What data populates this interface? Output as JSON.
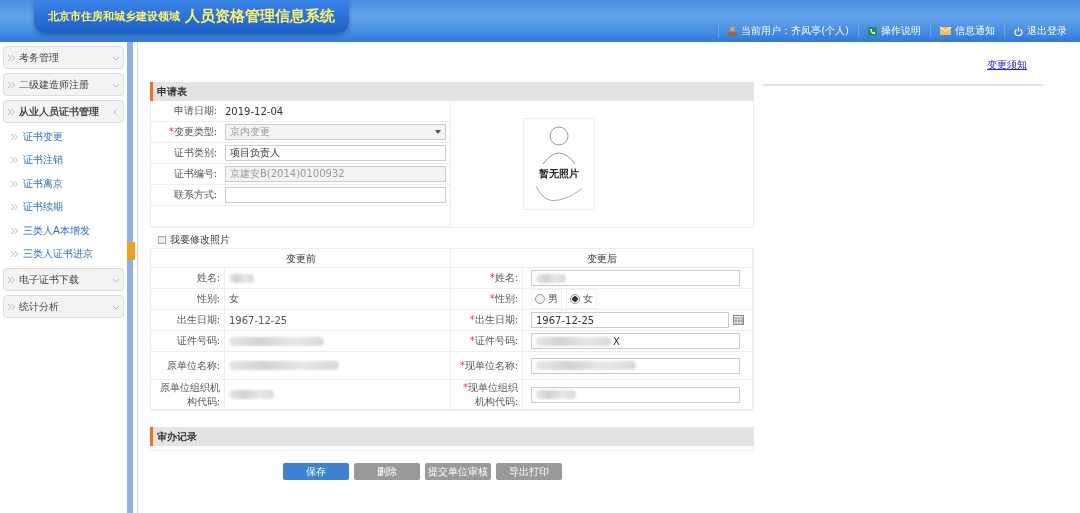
{
  "header": {
    "title_small": "北京市住房和城乡建设领域",
    "title_large": "人员资格管理信息系统",
    "links": [
      {
        "kind": "user",
        "label": "当前用户：齐凤亭(个人)"
      },
      {
        "kind": "help",
        "label": "操作说明"
      },
      {
        "kind": "mail",
        "label": "信息通知"
      },
      {
        "kind": "logout",
        "label": "退出登录"
      }
    ]
  },
  "sidebar": {
    "groups": [
      {
        "label": "考务管理",
        "expanded": false
      },
      {
        "label": "二级建造师注册",
        "expanded": false
      },
      {
        "label": "从业人员证书管理",
        "expanded": true,
        "children": [
          {
            "label": "证书变更"
          },
          {
            "label": "证书注销"
          },
          {
            "label": "证书离京"
          },
          {
            "label": "证书续期"
          },
          {
            "label": "三类人A本增发"
          },
          {
            "label": "三类人证书进京"
          }
        ]
      },
      {
        "label": "电子证书下载",
        "expanded": false
      },
      {
        "label": "统计分析",
        "expanded": false
      }
    ]
  },
  "notice_link": "变更须知",
  "form": {
    "title": "申请表",
    "fields": [
      {
        "kind": "text",
        "label": "申请日期:",
        "value": "2019-12-04"
      },
      {
        "kind": "select",
        "label": "变更类型:",
        "value": "京内变更",
        "required_mark": "*",
        "disabled": true
      },
      {
        "kind": "input",
        "label": "证书类别:",
        "value": "项目负责人"
      },
      {
        "kind": "input",
        "label": "证书编号:",
        "value": "京建安B(2014)0100932",
        "disabled": true
      },
      {
        "kind": "input",
        "label": "联系方式:"
      }
    ],
    "photo": {
      "text": "暂无照片"
    },
    "change_photo": {
      "label": "我要修改照片",
      "checked": false
    },
    "compare": {
      "before_title": "变更前",
      "after_title": "变更后",
      "rows": [
        {
          "before_label": "姓名:",
          "before": {
            "blurred": true
          },
          "after_mark": "*",
          "after_label": "姓名:",
          "after": {
            "kind": "input",
            "blurred": true
          }
        },
        {
          "before_label": "性别:",
          "before": {
            "value": "女",
            "blurred": false
          },
          "after_mark": "*",
          "after_label": "性别:",
          "after": {
            "kind": "radio",
            "options": [
              {
                "label": "男",
                "selected": false
              },
              {
                "label": "女",
                "selected": true
              }
            ]
          }
        },
        {
          "before_label": "出生日期:",
          "before": {
            "value": "1967-12-25",
            "blurred": false
          },
          "after_mark": "*",
          "after_label": "出生日期:",
          "after": {
            "kind": "date",
            "value": "1967-12-25",
            "blurred": false
          }
        },
        {
          "before_label": "证件号码:",
          "before": {
            "blurred": true
          },
          "after_mark": "*",
          "after_label": "证件号码:",
          "after": {
            "kind": "input",
            "value": "X",
            "blurred": true
          }
        },
        {
          "before_label": "原单位名称:",
          "before": {
            "blurred": true
          },
          "after_mark": "*",
          "after_label": "现单位名称:",
          "after": {
            "kind": "input",
            "blurred": true
          }
        },
        {
          "before_label": "原单位组织机构代码:",
          "before": {
            "blurred": true
          },
          "after_mark": "*",
          "after_label": "现单位组织机构代码:",
          "after": {
            "kind": "input",
            "blurred": true
          }
        }
      ]
    }
  },
  "review": {
    "title": "审办记录"
  },
  "buttons": [
    {
      "label": "保存",
      "primary": true
    },
    {
      "label": "删除",
      "primary": false
    },
    {
      "label": "提交单位审核",
      "primary": false
    },
    {
      "label": "导出打印",
      "primary": false
    }
  ]
}
